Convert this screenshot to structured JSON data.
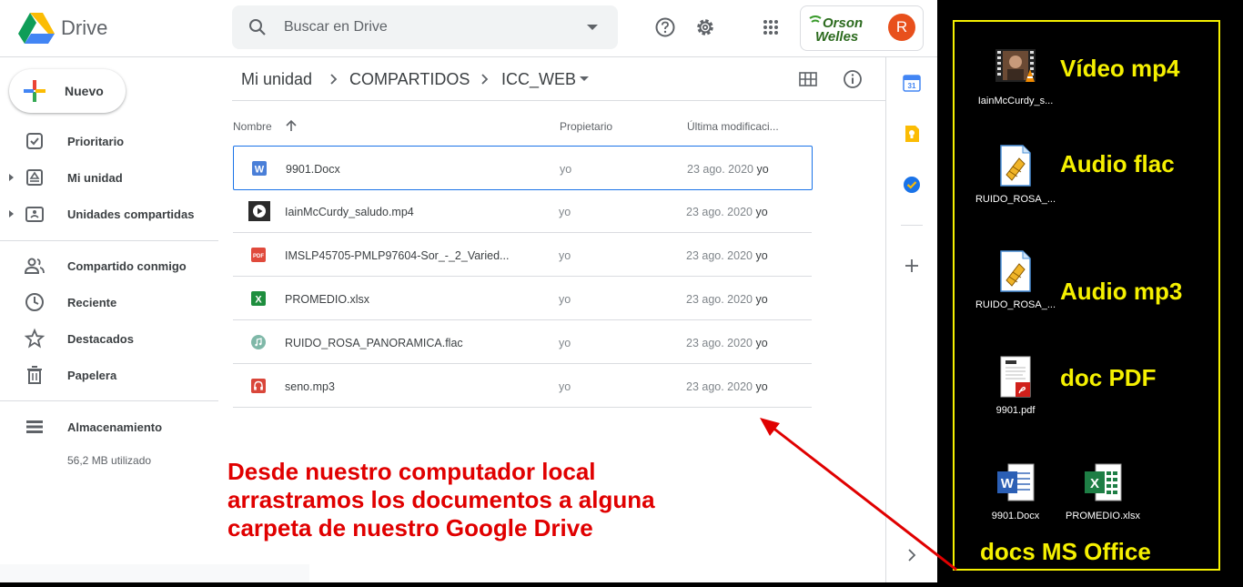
{
  "header": {
    "app_name": "Drive",
    "search_placeholder": "Buscar en Drive",
    "help_icon": "help-icon",
    "settings_icon": "gear-icon",
    "apps_icon": "apps-grid-icon",
    "brand_line1": "Orson",
    "brand_line2": "Welles",
    "avatar_initial": "R"
  },
  "sidebar": {
    "new_label": "Nuevo",
    "items": [
      {
        "label": "Prioritario",
        "icon": "priority-check-icon",
        "expandable": false
      },
      {
        "label": "Mi unidad",
        "icon": "my-drive-icon",
        "expandable": true
      },
      {
        "label": "Unidades compartidas",
        "icon": "shared-drives-icon",
        "expandable": true
      },
      {
        "label": "Compartido conmigo",
        "icon": "people-icon",
        "expandable": false
      },
      {
        "label": "Reciente",
        "icon": "clock-icon",
        "expandable": false
      },
      {
        "label": "Destacados",
        "icon": "star-icon",
        "expandable": false
      },
      {
        "label": "Papelera",
        "icon": "trash-icon",
        "expandable": false
      },
      {
        "label": "Almacenamiento",
        "icon": "storage-icon",
        "expandable": false
      }
    ],
    "storage_used": "56,2 MB utilizado"
  },
  "breadcrumb": {
    "items": [
      "Mi unidad",
      "COMPARTIDOS",
      "ICC_WEB"
    ],
    "grid_view_icon": "grid-view-icon",
    "info_icon": "info-icon"
  },
  "file_list": {
    "columns": [
      "Nombre",
      "Propietario",
      "Última modificaci..."
    ],
    "sort_icon": "arrow-up-icon",
    "rows": [
      {
        "name": "9901.Docx",
        "owner": "yo",
        "date": "23 ago. 2020",
        "by": "yo",
        "icon": "word-doc-icon",
        "selected": true
      },
      {
        "name": "IainMcCurdy_saludo.mp4",
        "owner": "yo",
        "date": "23 ago. 2020",
        "by": "yo",
        "icon": "video-thumbnail-icon",
        "selected": false
      },
      {
        "name": "IMSLP45705-PMLP97604-Sor_-_2_Varied...",
        "owner": "yo",
        "date": "23 ago. 2020",
        "by": "yo",
        "icon": "pdf-icon",
        "selected": false
      },
      {
        "name": "PROMEDIO.xlsx",
        "owner": "yo",
        "date": "23 ago. 2020",
        "by": "yo",
        "icon": "excel-icon",
        "selected": false
      },
      {
        "name": "RUIDO_ROSA_PANORAMICA.flac",
        "owner": "yo",
        "date": "23 ago. 2020",
        "by": "yo",
        "icon": "audio-icon",
        "selected": false
      },
      {
        "name": "seno.mp3",
        "owner": "yo",
        "date": "23 ago. 2020",
        "by": "yo",
        "icon": "headphones-icon",
        "selected": false
      }
    ]
  },
  "right_rail": {
    "icons": [
      "calendar-icon",
      "keep-icon",
      "tasks-icon",
      "plus-icon",
      "chevron-right-icon"
    ]
  },
  "annotation": {
    "lines": [
      "Desde nuestro computador local",
      "arrastramos los documentos a alguna",
      "carpeta de nuestro Google Drive"
    ],
    "color": "#e00000"
  },
  "desktop": {
    "border_color": "#f5f000",
    "icons": [
      {
        "caption": "IainMcCurdy_s...",
        "type": "video-file-icon"
      },
      {
        "caption": "RUIDO_ROSA_...",
        "type": "audio-file-icon"
      },
      {
        "caption": "RUIDO_ROSA_...",
        "type": "audio-file-icon"
      },
      {
        "caption": "9901.pdf",
        "type": "pdf-file-icon"
      },
      {
        "caption": "9901.Docx",
        "type": "word-file-icon"
      },
      {
        "caption": "PROMEDIO.xlsx",
        "type": "excel-file-icon"
      }
    ],
    "labels": [
      "Vídeo mp4",
      "Audio flac",
      "Audio mp3",
      "doc PDF",
      "docs MS Office"
    ]
  }
}
